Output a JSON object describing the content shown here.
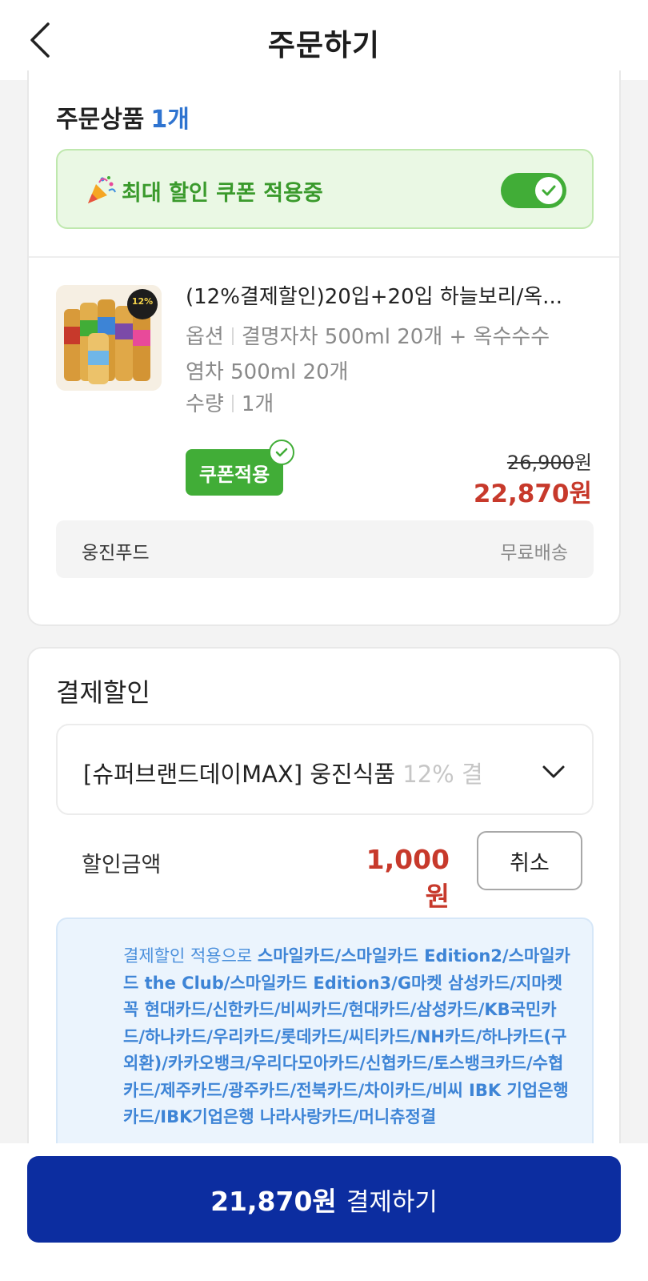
{
  "header": {
    "title": "주문하기"
  },
  "order": {
    "section_title": "주문상품",
    "item_count": "1개",
    "coupon_banner": {
      "text": "최대 할인 쿠폰 적용중",
      "toggle_on": true
    },
    "product": {
      "name": "(12%결제할인)20입+20입 하늘보리/옥...",
      "option_label": "옵션",
      "option_value_line1": "결명자차 500ml 20개 + 옥수수수",
      "option_value_line2": "염차 500ml 20개",
      "quantity_label": "수량",
      "quantity_value": "1개",
      "coupon_badge": "쿠폰적용",
      "original_price": "26,900",
      "currency": "원",
      "sale_price": "22,870원"
    },
    "seller": {
      "name": "웅진푸드",
      "shipping": "무료배송"
    }
  },
  "payment_discount": {
    "section_title": "결제할인",
    "selected_offer": "[슈퍼브랜드데이MAX] 웅진식품",
    "selected_offer_tail": "12% 결",
    "discount_label": "할인금액",
    "discount_amount": "1,000원",
    "cancel_label": "취소",
    "info_prefix": "결제할인 적용으로 ",
    "info_cards": "스마일카드/스마일카드 Edition2/스마일카드 the Club/스마일카드 Edition3/G마켓 삼성카드/지마켓 꼭 현대카드/신한카드/비씨카드/현대카드/삼성카드/KB국민카드/하나카드/우리카드/롯데카드/씨티카드/NH카드/하나카드(구외환)/카카오뱅크/우리다모아카드/신협카드/토스뱅크카드/수협카드/제주카드/광주카드/전북카드/차이카드/비씨 IBK 기업은행카드/IBK기업은행 나라사랑카드/머니츄정결"
  },
  "checkout": {
    "amount": "21,870원",
    "label": "결제하기"
  },
  "colors": {
    "brand_blue": "#0c2da0",
    "price_red": "#c7392b",
    "coupon_green": "#41ad37",
    "link_blue": "#2f74d0"
  }
}
